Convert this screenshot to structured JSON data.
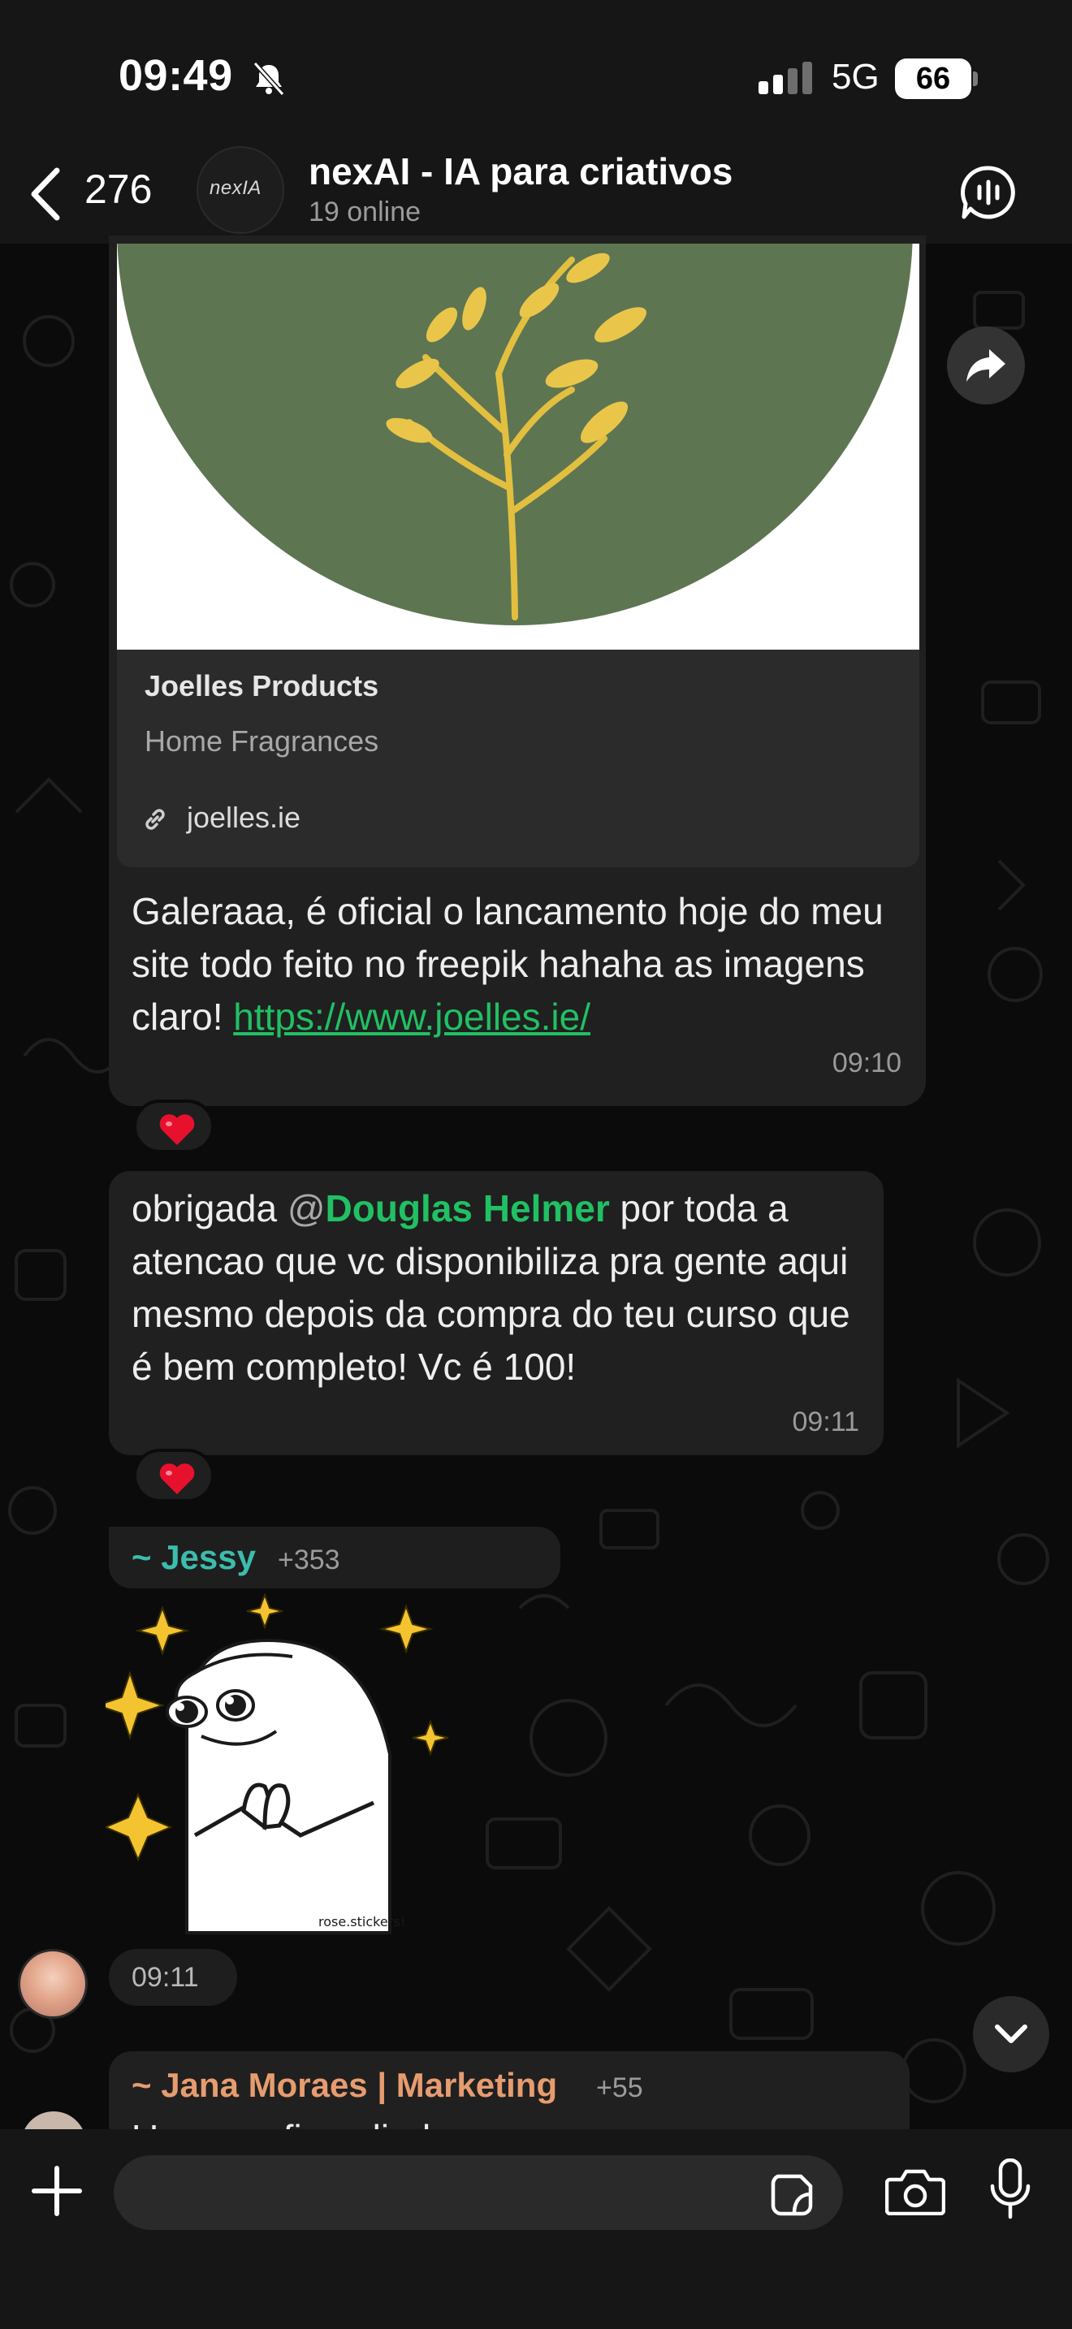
{
  "status_bar": {
    "time": "09:49",
    "network": "5G",
    "battery": "66"
  },
  "header": {
    "back_count": "276",
    "group_name": "nexAI - IA para criativos",
    "subtitle": "19 online",
    "avatar_logo_text": "nexIA"
  },
  "messages": {
    "link_preview": {
      "title": "Joelles Products",
      "description": "Home Fragrances",
      "domain": "joelles.ie"
    },
    "msg1": {
      "text": "Galeraaa, é oficial o lancamento hoje do meu site todo feito no freepik hahaha as imagens claro! ",
      "link": "https://www.joelles.ie/",
      "time": "09:10",
      "reaction": "❤️"
    },
    "msg2": {
      "text_before": "obrigada ",
      "at": "@",
      "mention": "Douglas Helmer",
      "text_after": " por toda a atencao que vc disponibiliza pra gente aqui mesmo depois da compra do teu curso que é bem completo! Vc é 100!",
      "time": "09:11",
      "reaction": "❤️"
    },
    "msg3": {
      "sender": "~ Jessy",
      "sender_count": "+353",
      "sticker_caption": "rose.stickers!",
      "time": "09:11"
    },
    "msg4": {
      "sender": "~ Jana Moraes | Marketing",
      "sender_count": "+55",
      "text": "Uauuu... ficou lindoooo"
    }
  },
  "colors": {
    "accent_green": "#21c063",
    "jessy_name": "#3cbcad",
    "jana_name": "#e79c6f",
    "bubble": "#202020",
    "background": "#0b0b0b"
  },
  "icons": {
    "back": "chevron-left-icon",
    "call": "voice-chat-icon",
    "forward": "forward-arrow-icon",
    "scroll": "chevron-down-icon",
    "plus": "plus-icon",
    "sticker": "sticker-icon",
    "camera": "camera-icon",
    "mic": "microphone-icon"
  }
}
